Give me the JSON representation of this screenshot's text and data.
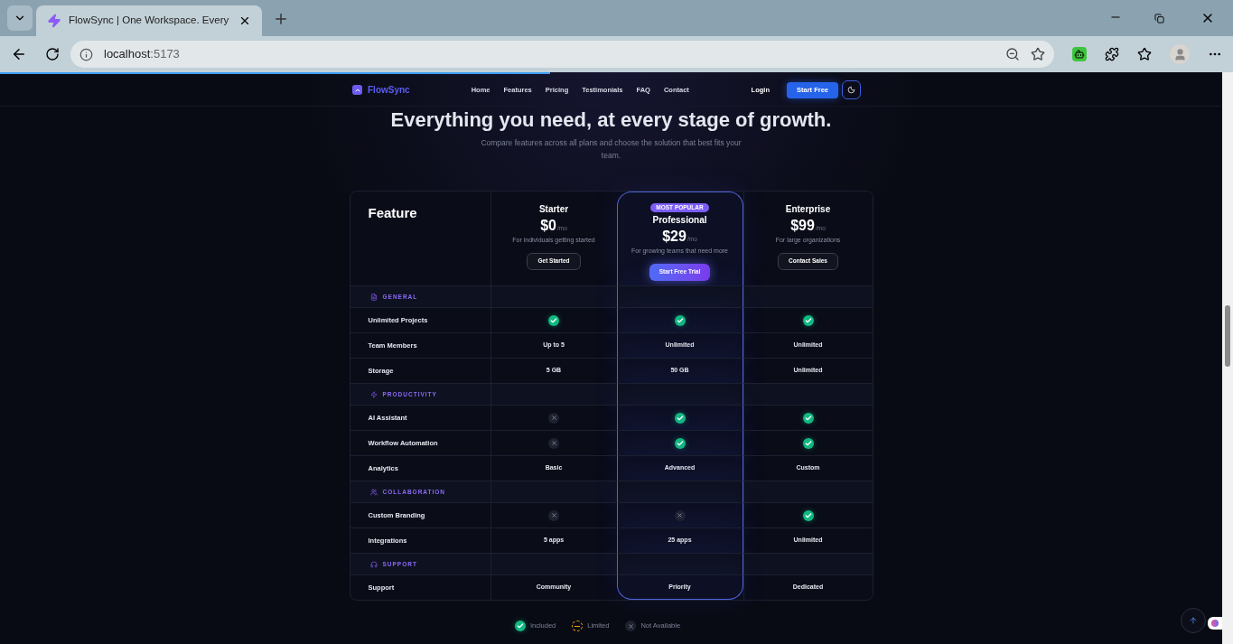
{
  "browser": {
    "tab_title": "FlowSync | One Workspace. Every",
    "url_host": "localhost",
    "url_port": ":5173"
  },
  "scroll_progress": {
    "level": 0.45
  },
  "nav": {
    "brand": "FlowSync",
    "links": [
      "Home",
      "Features",
      "Pricing",
      "Testimonials",
      "FAQ",
      "Contact"
    ],
    "login": "Login",
    "cta": "Start Free"
  },
  "heading": "Everything you need, at every stage of growth.",
  "subheading": "Compare features across all plans and choose the solution that best fits your team.",
  "table": {
    "feature_label": "Feature",
    "plans": [
      {
        "name": "Starter",
        "price": "$0",
        "period": "/mo",
        "description": "For individuals getting started",
        "button": "Get Started",
        "featured": false
      },
      {
        "name": "Professional",
        "price": "$29",
        "period": "/mo",
        "description": "For growing teams that need more",
        "button": "Start Free Trial",
        "featured": true,
        "badge": "MOST POPULAR"
      },
      {
        "name": "Enterprise",
        "price": "$99",
        "period": "/mo",
        "description": "For large organizations",
        "button": "Contact Sales",
        "featured": false
      }
    ],
    "sections": [
      {
        "title": "GENERAL",
        "kind": "file",
        "rows": [
          {
            "feature": "Unlimited Projects",
            "values": [
              {
                "kind": "check"
              },
              {
                "kind": "check"
              },
              {
                "kind": "check"
              }
            ]
          },
          {
            "feature": "Team Members",
            "values": [
              {
                "kind": "text",
                "text": "Up to 5"
              },
              {
                "kind": "text",
                "text": "Unlimited"
              },
              {
                "kind": "text",
                "text": "Unlimited"
              }
            ]
          },
          {
            "feature": "Storage",
            "values": [
              {
                "kind": "text",
                "text": "5 GB"
              },
              {
                "kind": "text",
                "text": "50 GB"
              },
              {
                "kind": "text",
                "text": "Unlimited"
              }
            ]
          }
        ]
      },
      {
        "title": "PRODUCTIVITY",
        "kind": "zap",
        "rows": [
          {
            "feature": "AI Assistant",
            "values": [
              {
                "kind": "cross"
              },
              {
                "kind": "check"
              },
              {
                "kind": "check"
              }
            ]
          },
          {
            "feature": "Workflow Automation",
            "values": [
              {
                "kind": "cross"
              },
              {
                "kind": "check"
              },
              {
                "kind": "check"
              }
            ]
          },
          {
            "feature": "Analytics",
            "values": [
              {
                "kind": "text",
                "text": "Basic"
              },
              {
                "kind": "text",
                "text": "Advanced"
              },
              {
                "kind": "text",
                "text": "Custom"
              }
            ]
          }
        ]
      },
      {
        "title": "COLLABORATION",
        "kind": "users",
        "rows": [
          {
            "feature": "Custom Branding",
            "values": [
              {
                "kind": "cross"
              },
              {
                "kind": "cross"
              },
              {
                "kind": "check"
              }
            ]
          },
          {
            "feature": "Integrations",
            "values": [
              {
                "kind": "text",
                "text": "5 apps"
              },
              {
                "kind": "text",
                "text": "25 apps"
              },
              {
                "kind": "text",
                "text": "Unlimited"
              }
            ]
          }
        ]
      },
      {
        "title": "SUPPORT",
        "kind": "headphones",
        "rows": [
          {
            "feature": "Support",
            "values": [
              {
                "kind": "text",
                "text": "Community"
              },
              {
                "kind": "text",
                "text": "Priority"
              },
              {
                "kind": "text",
                "text": "Dedicated"
              }
            ]
          }
        ]
      }
    ]
  },
  "legend": [
    {
      "kind": "check",
      "label": "Included"
    },
    {
      "kind": "limited",
      "label": "Limited"
    },
    {
      "kind": "cross",
      "label": "Not Available"
    }
  ]
}
